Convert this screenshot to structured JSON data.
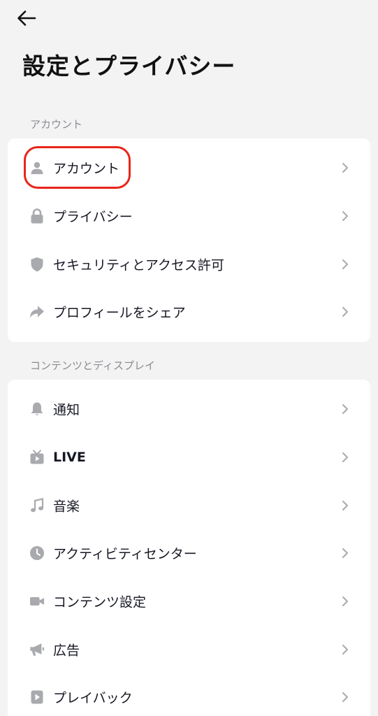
{
  "header": {
    "back_icon": "arrow-left-icon",
    "title": "設定とプライバシー"
  },
  "sections": [
    {
      "header": "アカウント",
      "items": [
        {
          "label": "アカウント",
          "icon": "person-icon",
          "highlighted": true
        },
        {
          "label": "プライバシー",
          "icon": "lock-icon"
        },
        {
          "label": "セキュリティとアクセス許可",
          "icon": "shield-icon"
        },
        {
          "label": "プロフィールをシェア",
          "icon": "share-arrow-icon"
        }
      ]
    },
    {
      "header": "コンテンツとディスプレイ",
      "items": [
        {
          "label": "通知",
          "icon": "bell-icon"
        },
        {
          "label": "LIVE",
          "icon": "tv-play-icon"
        },
        {
          "label": "音楽",
          "icon": "music-note-icon"
        },
        {
          "label": "アクティビティセンター",
          "icon": "clock-icon"
        },
        {
          "label": "コンテンツ設定",
          "icon": "video-camera-icon"
        },
        {
          "label": "広告",
          "icon": "megaphone-icon"
        },
        {
          "label": "プレイバック",
          "icon": "play-box-icon"
        }
      ]
    }
  ],
  "colors": {
    "background": "#f3f3f3",
    "card": "#ffffff",
    "icon": "#a9aaae",
    "highlight": "#e8261b",
    "text": "#161823",
    "section_header": "#8a8b91"
  }
}
